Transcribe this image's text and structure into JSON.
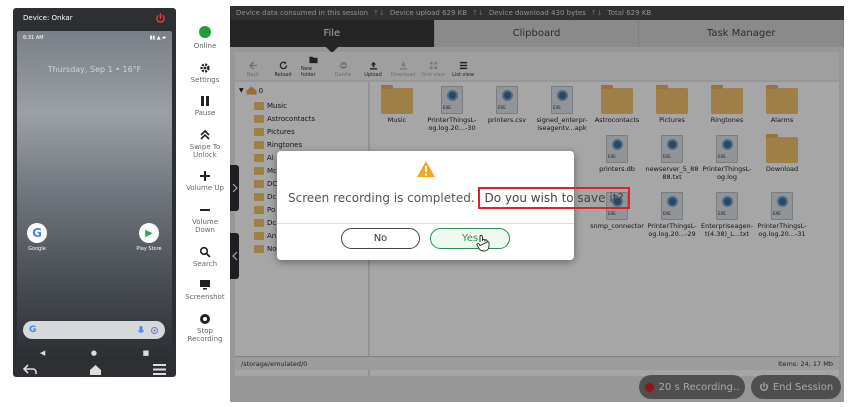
{
  "device": {
    "name_label": "Device: Onkar",
    "time": "6:31 AM",
    "date": "Thursday, Sep 1 • 16°F",
    "apps": [
      {
        "label": "Google",
        "glyph": "G",
        "color": "#4285f4"
      },
      {
        "label": "Play Store",
        "glyph": "▶",
        "color": "#34a853"
      }
    ],
    "search_glyph": "G"
  },
  "side_tools": [
    {
      "label": "Online",
      "icon": "online-dot"
    },
    {
      "label": "Settings",
      "icon": "gear-icon"
    },
    {
      "label": "Pause",
      "icon": "pause-icon"
    },
    {
      "label": "Swipe To Unlock",
      "icon": "double-chevron-up-icon"
    },
    {
      "label": "Volume Up",
      "icon": "plus-icon"
    },
    {
      "label": "Volume Down",
      "icon": "minus-icon"
    },
    {
      "label": "Search",
      "icon": "search-icon"
    },
    {
      "label": "Screenshot",
      "icon": "monitor-icon"
    },
    {
      "label": "Stop Recording",
      "icon": "stop-icon"
    }
  ],
  "stats": {
    "consumed": "Device data consumed in this session",
    "upload": "Device upload 629 KB",
    "download": "Device download 430 bytes",
    "total": "Total 629 KB"
  },
  "tabs": [
    {
      "label": "File",
      "active": true
    },
    {
      "label": "Clipboard",
      "active": false
    },
    {
      "label": "Task Manager",
      "active": false
    }
  ],
  "toolbar": [
    {
      "label": "Back",
      "disabled": true
    },
    {
      "label": "Reload",
      "disabled": false
    },
    {
      "label": "New folder",
      "disabled": false
    },
    {
      "label": "Delete",
      "disabled": true
    },
    {
      "label": "Upload",
      "disabled": false
    },
    {
      "label": "Download",
      "disabled": true
    },
    {
      "label": "Grid view",
      "disabled": true
    },
    {
      "label": "List view",
      "disabled": false
    }
  ],
  "tree": {
    "root": "0",
    "items": [
      "Music",
      "Astrocontacts",
      "Pictures",
      "Ringtones",
      "Al",
      "Mc",
      "DC",
      "Dc",
      "Po",
      "Dc",
      "An",
      "No"
    ]
  },
  "files": [
    {
      "name": "Music",
      "type": "folder"
    },
    {
      "name": "PrinterThingsL-og.log.20...-30",
      "type": "exe"
    },
    {
      "name": "printers.csv",
      "type": "exe"
    },
    {
      "name": "signed_enterpr-iseagentv...apk",
      "type": "exe"
    },
    {
      "name": "Astrocontacts",
      "type": "folder"
    },
    {
      "name": "Pictures",
      "type": "folder"
    },
    {
      "name": "Ringtones",
      "type": "folder"
    },
    {
      "name": "Alarms",
      "type": "folder"
    },
    {
      "name": "printers.db",
      "type": "exe"
    },
    {
      "name": "newserver_5_88 88.txt",
      "type": "exe"
    },
    {
      "name": "PrinterThingsL-og.log",
      "type": "exe"
    },
    {
      "name": "Download",
      "type": "folder"
    },
    {
      "name": "ons",
      "type": "partial"
    },
    {
      "name": "snmp_connector",
      "type": "exe"
    },
    {
      "name": "PrinterThingsL-og.log.20...-29",
      "type": "exe"
    },
    {
      "name": "Enterpriseagen-t(4.38)_L...txt",
      "type": "exe"
    },
    {
      "name": "PrinterThingsL-og.log.20...-31",
      "type": "exe"
    }
  ],
  "exe_tag": "EXE",
  "path_bar": {
    "path": "/storage/emulated/0",
    "items": "Items: 24, 17 Mb"
  },
  "recording": {
    "label": "20 s Recording..",
    "end_label": "End Session",
    "dot_color": "#e02020"
  },
  "dialog": {
    "message": "Screen recording is completed.",
    "question": "Do you wish to save it?",
    "no_label": "No",
    "yes_label": "Yes"
  }
}
